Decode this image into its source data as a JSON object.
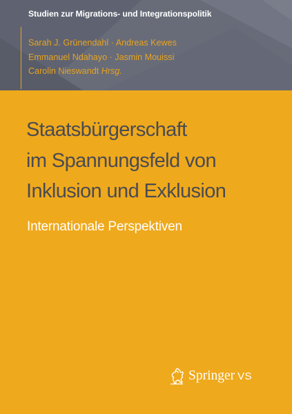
{
  "book": {
    "series": "Studien zur Migrations- und Integrationspolitik",
    "editors": {
      "line1": "Sarah J. Grünendahl · Andreas Kewes",
      "line2": "Emmanuel Ndahayo · Jasmin Mouissi",
      "line3_name": "Carolin Nieswandt ",
      "line3_role": "Hrsg."
    },
    "title_lines": [
      "Staatsbürgerschaft",
      "im Spannungsfeld von",
      "Inklusion und Exklusion"
    ],
    "subtitle": "Internationale Perspektiven",
    "publisher": {
      "name": "Springer",
      "imprint": "VS",
      "logo_icon": "springer-horse-icon"
    }
  },
  "colors": {
    "cover_background": "#EFA91C",
    "top_band": "#5F6371",
    "title_text": "#4A4B52",
    "editor_text": "#E7A320",
    "white_text": "#FFFFFF"
  }
}
